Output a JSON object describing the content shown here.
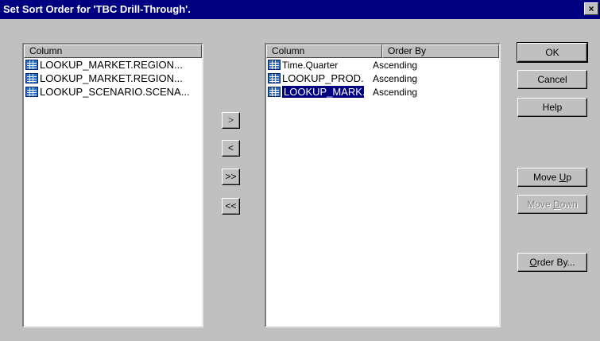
{
  "window": {
    "title": "Set Sort Order for 'TBC Drill-Through'.",
    "close_label": "×"
  },
  "left_list": {
    "header": "Column",
    "items": [
      "LOOKUP_MARKET.REGION...",
      "LOOKUP_MARKET.REGION...",
      "LOOKUP_SCENARIO.SCENA..."
    ]
  },
  "move_buttons": {
    "add": ">",
    "remove": "<",
    "add_all": ">>",
    "remove_all": "<<"
  },
  "right_list": {
    "headers": {
      "column": "Column",
      "order": "Order By"
    },
    "rows": [
      {
        "column": "Time.Quarter",
        "order": "Ascending",
        "selected": false
      },
      {
        "column": "LOOKUP_PROD...",
        "order": "Ascending",
        "selected": false
      },
      {
        "column": "LOOKUP_MARK...",
        "order": "Ascending",
        "selected": true
      }
    ]
  },
  "buttons": {
    "ok": "OK",
    "cancel": "Cancel",
    "help": "Help",
    "move_up": {
      "before": "Move ",
      "key": "U",
      "after": "p"
    },
    "move_down": {
      "before": "Move ",
      "key": "D",
      "after": "own"
    },
    "order_by": {
      "before": "",
      "key": "O",
      "after": "rder By..."
    }
  },
  "colors": {
    "title_bar": "#000080",
    "dialog_bg": "#c0c0c0",
    "selection": "#000080"
  }
}
